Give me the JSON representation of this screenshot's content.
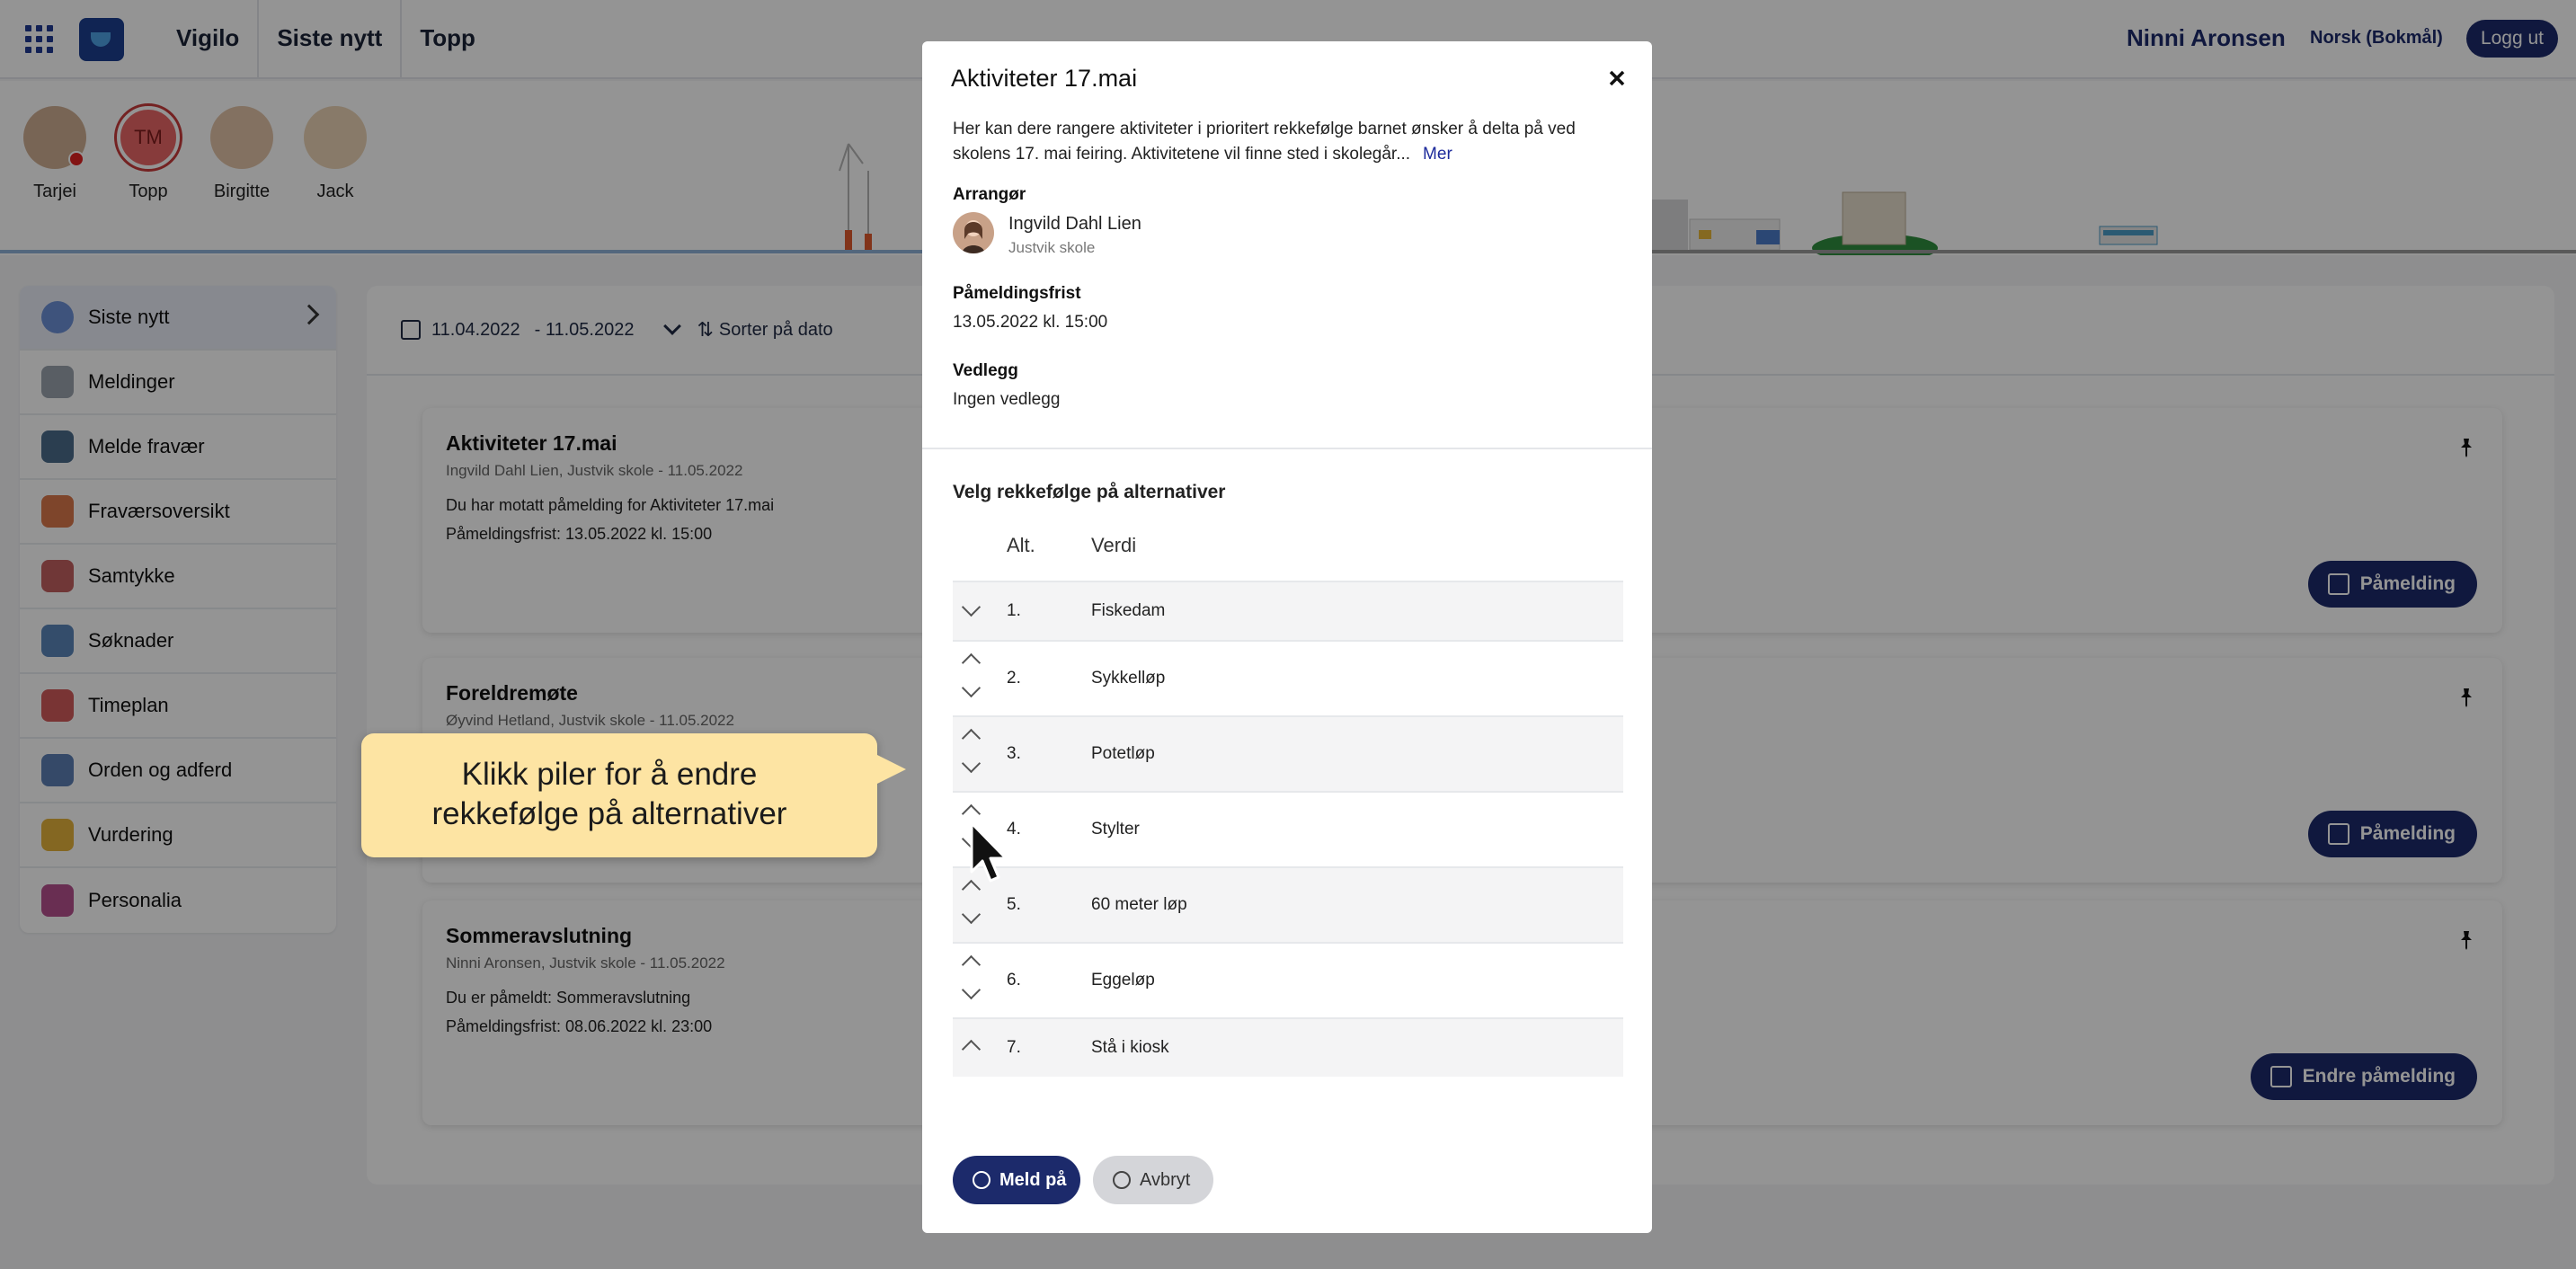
{
  "topbar": {
    "nav": [
      "Vigilo",
      "Siste nytt",
      "Topp"
    ],
    "user_name": "Ninni Aronsen",
    "language": "Norsk (Bokmål)",
    "logout": "Logg ut"
  },
  "children": [
    {
      "name": "Tarjei",
      "initials": "",
      "has_notification": true
    },
    {
      "name": "Topp",
      "initials": "TM",
      "has_notification": false
    },
    {
      "name": "Birgitte",
      "initials": "",
      "has_notification": false
    },
    {
      "name": "Jack",
      "initials": "",
      "has_notification": false
    }
  ],
  "sidebar": {
    "items": [
      {
        "label": "Siste nytt",
        "icon": "user-news-icon",
        "color": "#6c8fd6"
      },
      {
        "label": "Meldinger",
        "icon": "envelope-icon",
        "color": "#9aa3ad"
      },
      {
        "label": "Melde fravær",
        "icon": "clock-icon",
        "color": "#4a6b8a"
      },
      {
        "label": "Fraværsoversikt",
        "icon": "person-absence-icon",
        "color": "#d9774a"
      },
      {
        "label": "Samtykke",
        "icon": "clipboard-check-icon",
        "color": "#c26060"
      },
      {
        "label": "Søknader",
        "icon": "magnifier-document-icon",
        "color": "#5b86b9"
      },
      {
        "label": "Timeplan",
        "icon": "calendar-icon",
        "color": "#d05a5a"
      },
      {
        "label": "Orden og adferd",
        "icon": "document-search-icon",
        "color": "#5c7fb3"
      },
      {
        "label": "Vurdering",
        "icon": "medal-icon",
        "color": "#e3b23c"
      },
      {
        "label": "Personalia",
        "icon": "fingerprint-icon",
        "color": "#b5508e"
      }
    ]
  },
  "feed": {
    "date_from": "11.04.2022",
    "date_to": "- 11.05.2022",
    "sort_label": "Sorter på dato",
    "cards": [
      {
        "title": "Aktiviteter 17.mai",
        "meta": "Ingvild Dahl Lien, Justvik skole - 11.05.2022",
        "line1": "Du har motatt påmelding for Aktiviteter 17.mai",
        "line2": "Påmeldingsfrist: 13.05.2022 kl. 15:00",
        "button": "Påmelding"
      },
      {
        "title": "Foreldremøte",
        "meta": "Øyvind Hetland, Justvik skole - 11.05.2022",
        "line1": "",
        "line2": "",
        "button": "Påmelding"
      },
      {
        "title": "Sommeravslutning",
        "meta": "Ninni Aronsen, Justvik skole - 11.05.2022",
        "line1": "Du er påmeldt: Sommeravslutning",
        "line2": "Påmeldingsfrist: 08.06.2022 kl. 23:00",
        "button": "Endre påmelding"
      }
    ]
  },
  "modal": {
    "title": "Aktiviteter 17.mai",
    "description": "Her kan dere rangere aktiviteter i prioritert rekkefølge barnet ønsker å delta på ved skolens 17. mai feiring. Aktivitetene vil finne sted i skolegår...",
    "more_link": "Mer",
    "organizer_label": "Arrangør",
    "organizer_name": "Ingvild Dahl Lien",
    "organizer_school": "Justvik skole",
    "deadline_label": "Påmeldingsfrist",
    "deadline_value": "13.05.2022 kl. 15:00",
    "attachment_label": "Vedlegg",
    "attachment_value": "Ingen vedlegg",
    "section_title": "Velg rekkefølge på alternativer",
    "col_alt": "Alt.",
    "col_value": "Verdi",
    "options": [
      {
        "num": "1.",
        "label": "Fiskedam",
        "up": false,
        "down": true
      },
      {
        "num": "2.",
        "label": "Sykkelløp",
        "up": true,
        "down": true
      },
      {
        "num": "3.",
        "label": "Potetløp",
        "up": true,
        "down": true
      },
      {
        "num": "4.",
        "label": "Stylter",
        "up": true,
        "down": true
      },
      {
        "num": "5.",
        "label": "60 meter løp",
        "up": true,
        "down": true
      },
      {
        "num": "6.",
        "label": "Eggeløp",
        "up": true,
        "down": true
      },
      {
        "num": "7.",
        "label": "Stå i kiosk",
        "up": true,
        "down": false
      }
    ],
    "submit": "Meld på",
    "cancel": "Avbryt"
  },
  "callout": {
    "text_line1": "Klikk piler for å endre",
    "text_line2": "rekkefølge på alternativer"
  },
  "colors": {
    "brand": "#1c2a6b",
    "callout_bg": "#fde4a3",
    "overlay": "rgba(0,0,0,0.42)"
  }
}
